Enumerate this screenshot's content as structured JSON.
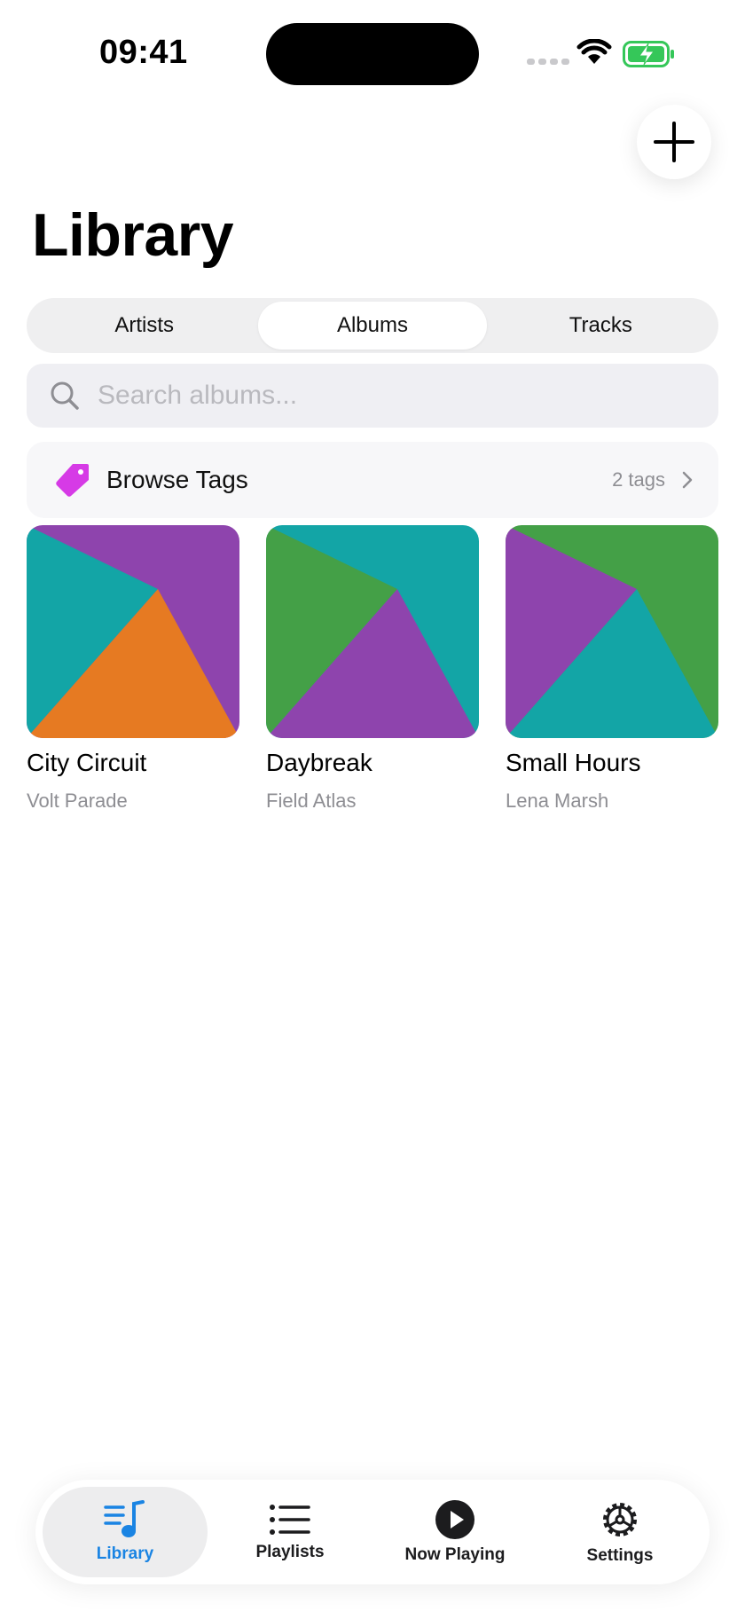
{
  "status_bar": {
    "time": "09:41"
  },
  "header": {
    "title": "Library"
  },
  "segments": [
    {
      "label": "Artists",
      "active": false
    },
    {
      "label": "Albums",
      "active": true
    },
    {
      "label": "Tracks",
      "active": false
    }
  ],
  "search": {
    "placeholder": "Search albums...",
    "value": ""
  },
  "browse_tags": {
    "label": "Browse Tags",
    "count": "2 tags",
    "icon": "tag-icon",
    "icon_color": "#d63ae6"
  },
  "albums": [
    {
      "title": "City Circuit",
      "artist": "Volt Parade",
      "cover_colors": [
        "#8e44ad",
        "#13a5a6",
        "#e67a22"
      ]
    },
    {
      "title": "Daybreak",
      "artist": "Field Atlas",
      "cover_colors": [
        "#13a5a6",
        "#44a047",
        "#8e44ad"
      ]
    },
    {
      "title": "Small Hours",
      "artist": "Lena Marsh",
      "cover_colors": [
        "#44a047",
        "#8e44ad",
        "#13a5a6"
      ]
    }
  ],
  "tab_bar": [
    {
      "label": "Library",
      "icon": "music-library-icon",
      "active": true
    },
    {
      "label": "Playlists",
      "icon": "list-icon",
      "active": false
    },
    {
      "label": "Now Playing",
      "icon": "play-circle-icon",
      "active": false
    },
    {
      "label": "Settings",
      "icon": "gear-icon",
      "active": false
    }
  ],
  "colors": {
    "accent": "#1a84e3",
    "battery": "#35c759"
  }
}
